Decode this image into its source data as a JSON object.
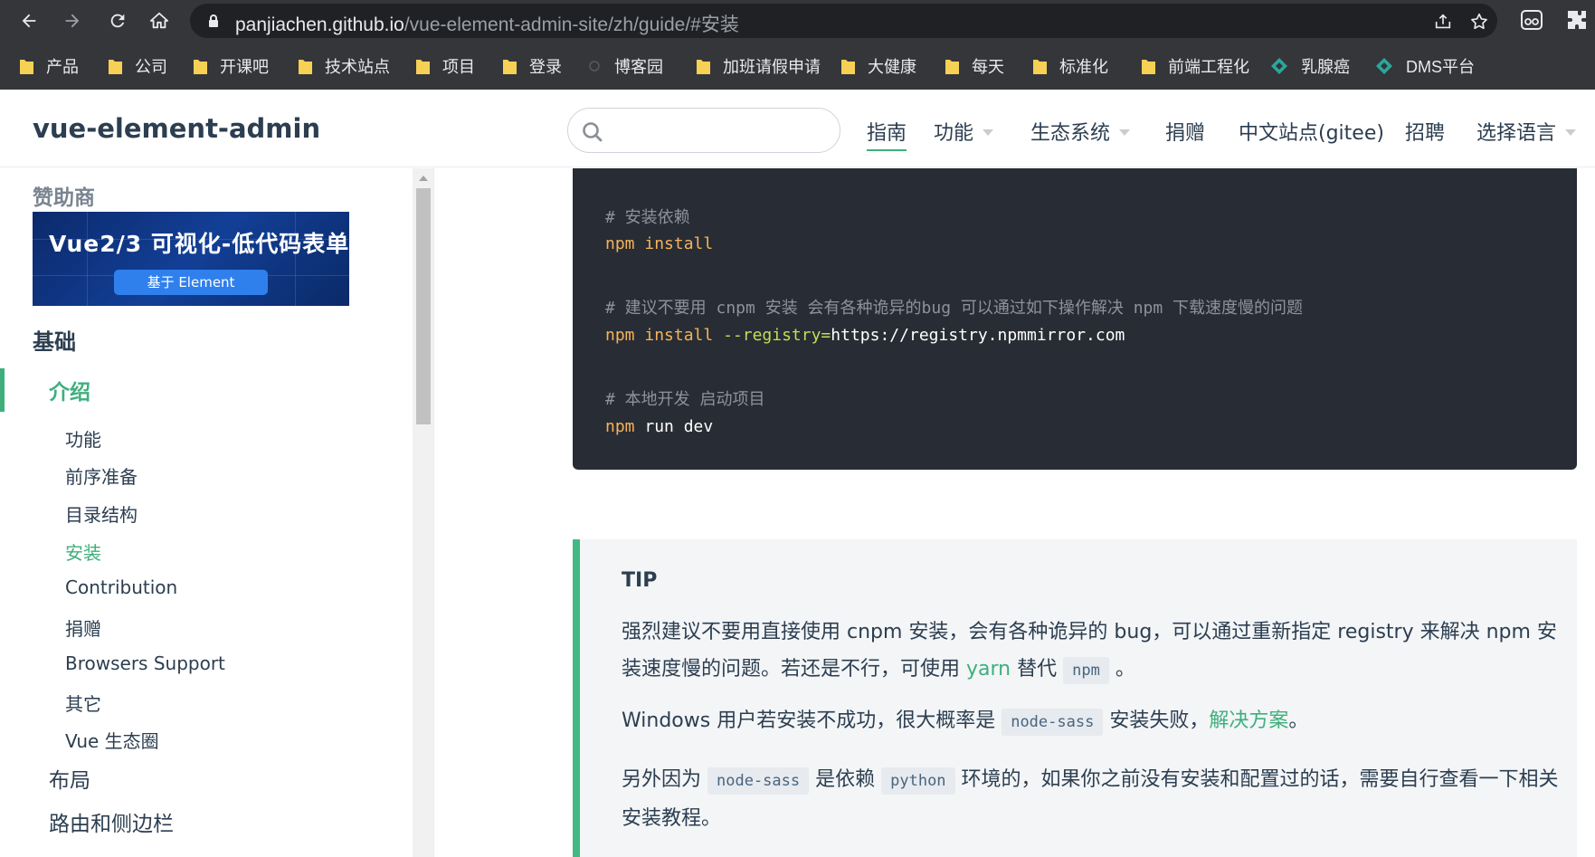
{
  "browser": {
    "url_host": "panjiachen.github.io",
    "url_path": "/vue-element-admin-site/zh/guide/#安装",
    "bookmarks": [
      {
        "label": "产品",
        "icon": "folder-icon"
      },
      {
        "label": "公司",
        "icon": "folder-icon"
      },
      {
        "label": "开课吧",
        "icon": "folder-icon"
      },
      {
        "label": "技术站点",
        "icon": "folder-icon"
      },
      {
        "label": "项目",
        "icon": "folder-icon"
      },
      {
        "label": "登录",
        "icon": "folder-icon"
      },
      {
        "label": "博客园",
        "icon": "site-icon"
      },
      {
        "label": "加班请假申请",
        "icon": "folder-icon"
      },
      {
        "label": "大健康",
        "icon": "folder-icon"
      },
      {
        "label": "每天",
        "icon": "folder-icon"
      },
      {
        "label": "标准化",
        "icon": "folder-icon"
      },
      {
        "label": "前端工程化",
        "icon": "folder-icon"
      },
      {
        "label": "乳腺癌",
        "icon": "diamond-icon"
      },
      {
        "label": "DMS平台",
        "icon": "diamond-icon"
      }
    ]
  },
  "navbar": {
    "site_name": "vue-element-admin",
    "search_placeholder": "",
    "items": [
      {
        "label": "指南",
        "active": true,
        "dropdown": false
      },
      {
        "label": "功能",
        "active": false,
        "dropdown": true
      },
      {
        "label": "生态系统",
        "active": false,
        "dropdown": true
      },
      {
        "label": "捐赠",
        "active": false,
        "dropdown": false
      },
      {
        "label": "中文站点(gitee)",
        "active": false,
        "dropdown": false
      },
      {
        "label": "招聘",
        "active": false,
        "dropdown": false
      },
      {
        "label": "选择语言",
        "active": false,
        "dropdown": true
      }
    ]
  },
  "sidebar": {
    "sponsor_title": "赞助商",
    "sponsor_banner": {
      "headline": "Vue2/3 可视化-低代码表单",
      "pill": "基于 Element"
    },
    "group_basics": "基础",
    "items": [
      {
        "label": "介绍",
        "level": 1,
        "active": true
      },
      {
        "label": "功能",
        "level": 2,
        "active": false
      },
      {
        "label": "前序准备",
        "level": 2,
        "active": false
      },
      {
        "label": "目录结构",
        "level": 2,
        "active": false
      },
      {
        "label": "安装",
        "level": 2,
        "active": true
      },
      {
        "label": "Contribution",
        "level": 2,
        "active": false
      },
      {
        "label": "捐赠",
        "level": 2,
        "active": false
      },
      {
        "label": "Browsers Support",
        "level": 2,
        "active": false
      },
      {
        "label": "其它",
        "level": 2,
        "active": false
      },
      {
        "label": "Vue 生态圈",
        "level": 2,
        "active": false
      },
      {
        "label": "布局",
        "level": 1,
        "active": false
      },
      {
        "label": "路由和侧边栏",
        "level": 1,
        "active": false
      }
    ]
  },
  "code": {
    "comment1": "# 安装依赖",
    "line1_cmd": "npm",
    "line1_arg": "install",
    "comment2": "# 建议不要用 cnpm 安装 会有各种诡异的bug 可以通过如下操作解决 npm 下载速度慢的问题",
    "line2_cmd": "npm",
    "line2_arg": "install",
    "line2_opt": "--registry=",
    "line2_url": "https://registry.npmmirror.com",
    "comment3": "# 本地开发 启动项目",
    "line3_cmd": "npm",
    "line3_arg": "run dev"
  },
  "tip": {
    "title": "TIP",
    "p1_a": "强烈建议不要用直接使用 cnpm 安装，会有各种诡异的 bug，可以通过重新指定 registry 来解决 npm 安装速度慢的问题。若还是不行，可使用 ",
    "p1_link": "yarn",
    "p1_b": " 替代 ",
    "p1_code": "npm",
    "p1_c": " 。",
    "p2_a": "Windows 用户若安装不成功，很大概率是 ",
    "p2_code": "node-sass",
    "p2_b": " 安装失败，",
    "p2_link": "解决方案",
    "p2_c": "。",
    "p3_a": "另外因为 ",
    "p3_code1": "node-sass",
    "p3_b": " 是依赖 ",
    "p3_code2": "python",
    "p3_c": " 环境的，如果你之前没有安装和配置过的话，需要自行查看一下相关安装教程。"
  },
  "colors": {
    "accent": "#3eaf7c",
    "code_bg": "#282c34",
    "chrome_bg": "#35363a"
  }
}
